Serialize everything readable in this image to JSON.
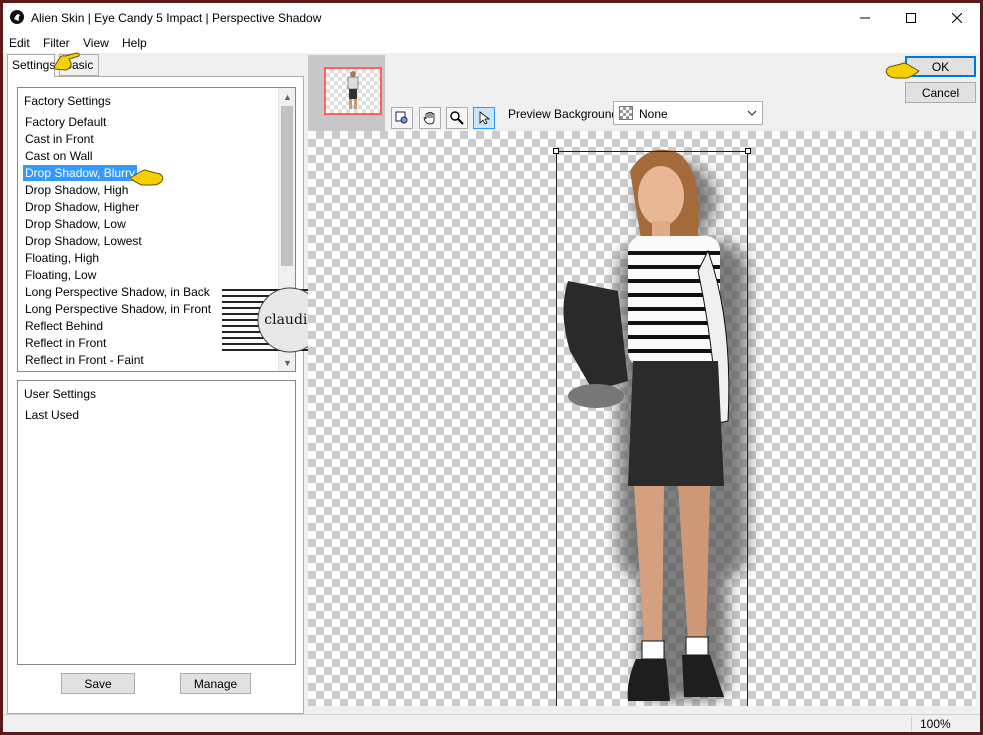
{
  "window": {
    "title": "Alien Skin | Eye Candy 5 Impact | Perspective Shadow"
  },
  "menu": [
    "Edit",
    "Filter",
    "View",
    "Help"
  ],
  "tabs": {
    "settings": "Settings",
    "basic": "Basic"
  },
  "factory": {
    "header": "Factory Settings",
    "items": [
      "Factory Default",
      "Cast in Front",
      "Cast on Wall",
      "Drop Shadow, Blurry",
      "Drop Shadow, High",
      "Drop Shadow, Higher",
      "Drop Shadow, Low",
      "Drop Shadow, Lowest",
      "Floating, High",
      "Floating, Low",
      "Long Perspective Shadow, in Back",
      "Long Perspective Shadow, in Front",
      "Reflect Behind",
      "Reflect in Front",
      "Reflect in Front - Faint"
    ],
    "selected": "Drop Shadow, Blurry"
  },
  "user": {
    "header": "User Settings",
    "items": [
      "Last Used"
    ]
  },
  "buttons": {
    "save": "Save",
    "manage": "Manage",
    "ok": "OK",
    "cancel": "Cancel"
  },
  "preview": {
    "background_label": "Preview Background:",
    "background_value": "None"
  },
  "watermark": "claudia",
  "status": {
    "zoom": "100%"
  },
  "colors": {
    "selection": "#3399ff",
    "pointer": "#f5d000",
    "thumbnail_frame": "#ff6060"
  },
  "icons": [
    "app-icon",
    "minimize-icon",
    "maximize-icon",
    "close-icon",
    "navigator-icon",
    "hand-icon",
    "zoom-icon",
    "arrow-icon",
    "pointing-hand-icon"
  ]
}
